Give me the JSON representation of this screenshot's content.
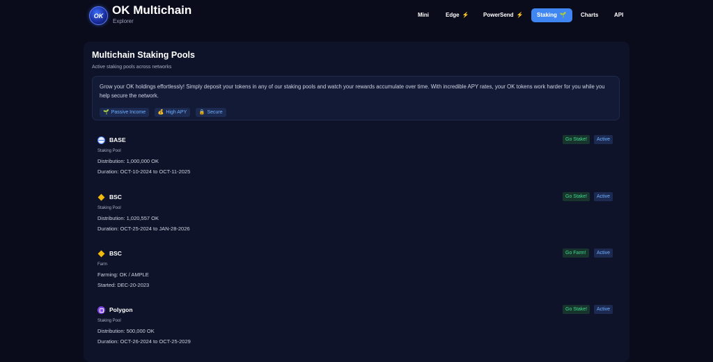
{
  "brand": {
    "title": "OK Multichain",
    "subtitle": "Explorer",
    "logo_text": "OK"
  },
  "nav": [
    {
      "label": "Mini",
      "bolt": ""
    },
    {
      "label": "Edge",
      "bolt": "⚡"
    },
    {
      "label": "PowerSend",
      "bolt": "⚡"
    },
    {
      "label": "Staking",
      "bolt": "🌱",
      "active": true
    },
    {
      "label": "Charts",
      "bolt": ""
    },
    {
      "label": "API",
      "bolt": ""
    }
  ],
  "card": {
    "title": "Multichain Staking Pools",
    "subtitle": "Active staking pools across networks",
    "intro": "Grow your OK holdings effortlessly! Simply deposit your tokens in any of our staking pools and watch your rewards accumulate over time. With incredible APY rates, your OK tokens work harder for you while you help secure the network.",
    "tags": [
      {
        "icon": "🌱",
        "label": "Passive Income"
      },
      {
        "icon": "💰",
        "label": "High APY"
      },
      {
        "icon": "🔒",
        "label": "Secure"
      }
    ]
  },
  "pools": [
    {
      "icon": "base",
      "name": "BASE",
      "type": "Staking Pool",
      "line1": "Distribution: 1,000,000 OK",
      "line2": "Duration: OCT-10-2024 to OCT-11-2025",
      "action": "Go Stake!",
      "status": "Active"
    },
    {
      "icon": "bsc",
      "name": "BSC",
      "type": "Staking Pool",
      "line1": "Distribution: 1,020,557 OK",
      "line2": "Duration: OCT-25-2024 to JAN-28-2026",
      "action": "Go Stake!",
      "status": "Active"
    },
    {
      "icon": "bsc",
      "name": "BSC",
      "type": "Farm",
      "line1": "Farming: OK / AMPLE",
      "line2": "Started: DEC-20-2023",
      "action": "Go Farm!",
      "status": "Active"
    },
    {
      "icon": "polygon",
      "name": "Polygon",
      "type": "Staking Pool",
      "line1": "Distribution: 500,000 OK",
      "line2": "Duration: OCT-26-2024 to OCT-25-2029",
      "action": "Go Stake!",
      "status": "Active"
    }
  ]
}
